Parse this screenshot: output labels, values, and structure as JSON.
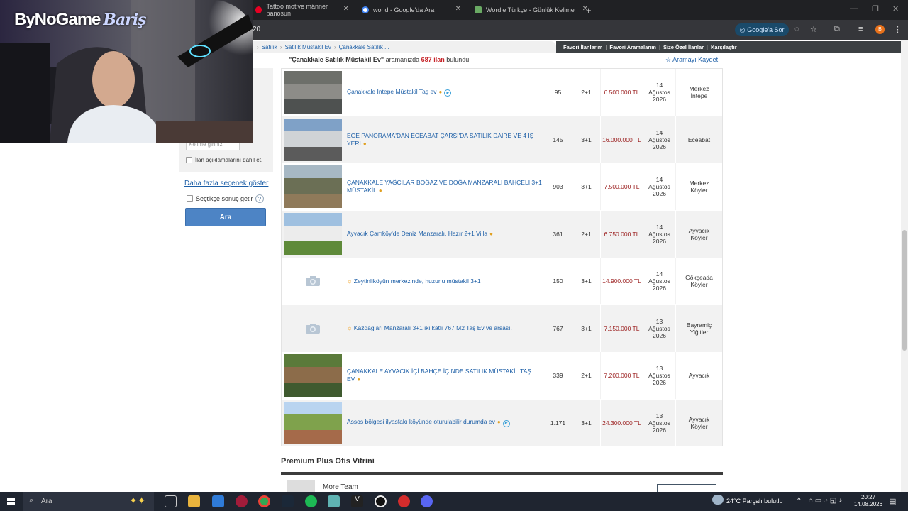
{
  "browser": {
    "tabs": [
      {
        "title": "Tattoo motive männer panosun",
        "favicon_color": "#e60023"
      },
      {
        "title": "world - Google'da Ara",
        "favicon_color": "#4285f4"
      },
      {
        "title": "Wordle Türkçe - Günlük Kelime",
        "favicon_color": "#6aaa64"
      }
    ],
    "new_tab": "+",
    "url_fragment": "20",
    "google_sor_label": "Google'a Sor",
    "profile_letter": "B"
  },
  "webcam": {
    "logo": "ByNoGame",
    "signature": "Bariş"
  },
  "breadcrumb": [
    "Satılık",
    "Satılık Müstakil Ev",
    "Çanakkale Satılık ..."
  ],
  "fav_bar": [
    "Favori İlanlarım",
    "Favori Aramalarım",
    "Size Özel İlanlar",
    "Karşılaştır"
  ],
  "result_info": {
    "query": "\"Çanakkale Satılık Müstakil Ev\"",
    "middle": "aramanızda",
    "count": "687 ilan",
    "suffix": "bulundu.",
    "save_search": "Aramayı Kaydet"
  },
  "sidebar": {
    "keyword_placeholder": "Kelime giriniz",
    "include_desc_label": "İlan açıklamalarını dahil et.",
    "more_options": "Daha fazla seçenek göster",
    "selected_label": "Seçtikçe sonuç getir",
    "help": "?",
    "search_button": "Ara"
  },
  "listings": [
    {
      "title": "Çanakkale İntepe Müstakil Taş ev",
      "m2": "95",
      "rooms": "2+1",
      "price": "6.500.000 TL",
      "date": [
        "14",
        "Ağustos",
        "2026"
      ],
      "location": [
        "Merkez",
        "İntepe"
      ],
      "photo": true,
      "bulb": true,
      "video": true,
      "sun": false
    },
    {
      "title": "EGE PANORAMA'DAN ECEABAT ÇARŞI'DA SATILIK DAİRE VE 4 İŞ YERİ",
      "m2": "145",
      "rooms": "3+1",
      "price": "16.000.000 TL",
      "date": [
        "14",
        "Ağustos",
        "2026"
      ],
      "location": [
        "Eceabat"
      ],
      "photo": true,
      "bulb": true,
      "video": false,
      "sun": false
    },
    {
      "title": "ÇANAKKALE YAĞCILAR BOĞAZ VE DOĞA MANZARALI BAHÇELİ 3+1 MÜSTAKİL",
      "m2": "903",
      "rooms": "3+1",
      "price": "7.500.000 TL",
      "date": [
        "14",
        "Ağustos",
        "2026"
      ],
      "location": [
        "Merkez",
        "Köyler"
      ],
      "photo": true,
      "bulb": true,
      "video": false,
      "sun": false
    },
    {
      "title": "Ayvacık Çamköy'de Deniz Manzaralı, Hazır 2+1 Villa",
      "m2": "361",
      "rooms": "2+1",
      "price": "6.750.000 TL",
      "date": [
        "14",
        "Ağustos",
        "2026"
      ],
      "location": [
        "Ayvacık",
        "Köyler"
      ],
      "photo": true,
      "bulb": true,
      "video": false,
      "sun": false
    },
    {
      "title": "Zeytinliköyün merkezinde, huzurlu müstakil 3+1",
      "m2": "150",
      "rooms": "3+1",
      "price": "14.900.000 TL",
      "date": [
        "14",
        "Ağustos",
        "2026"
      ],
      "location": [
        "Gökçeada",
        "Köyler"
      ],
      "photo": false,
      "bulb": false,
      "video": false,
      "sun": true
    },
    {
      "title": "Kazdağları Manzaralı 3+1 iki katlı 767 M2 Taş Ev ve arsası.",
      "m2": "767",
      "rooms": "3+1",
      "price": "7.150.000 TL",
      "date": [
        "13",
        "Ağustos",
        "2026"
      ],
      "location": [
        "Bayramiç",
        "Yiğitler"
      ],
      "photo": false,
      "bulb": false,
      "video": false,
      "sun": true
    },
    {
      "title": "ÇANAKKALE AYVACIK İÇİ BAHÇE İÇİNDE SATILIK MÜSTAKİL TAŞ EV",
      "m2": "339",
      "rooms": "2+1",
      "price": "7.200.000 TL",
      "date": [
        "13",
        "Ağustos",
        "2026"
      ],
      "location": [
        "Ayvacık"
      ],
      "photo": true,
      "bulb": true,
      "video": false,
      "sun": false
    },
    {
      "title": "Assos bölgesi ilyasfakı köyünde oturulabilir durumda ev",
      "m2": "1.171",
      "rooms": "3+1",
      "price": "24.300.000 TL",
      "date": [
        "13",
        "Ağustos",
        "2026"
      ],
      "location": [
        "Ayvacık",
        "Köyler"
      ],
      "photo": true,
      "bulb": true,
      "video": true,
      "sun": false
    }
  ],
  "premium": {
    "title": "Premium Plus Ofis Vitrini",
    "first_office": "More Team"
  },
  "taskbar": {
    "search_placeholder": "Ara",
    "weather": "24°C  Parçalı bulutlu",
    "time": "20:27",
    "date": "14.08.2026"
  }
}
